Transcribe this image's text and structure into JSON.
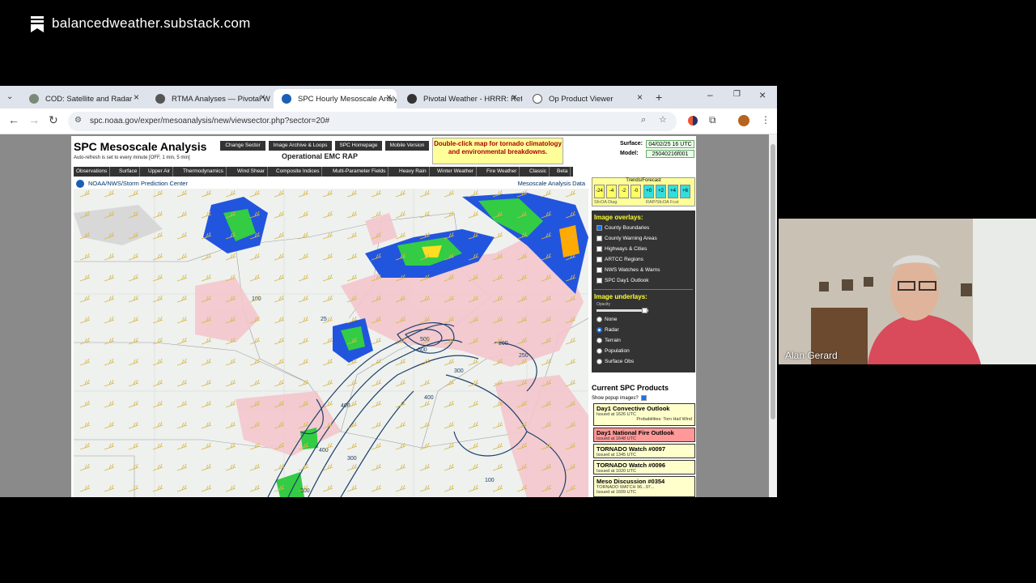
{
  "publication": {
    "title": "balancedweather.substack.com",
    "icon": "bookmark-icon"
  },
  "browser": {
    "tabs": [
      {
        "label": "COD: Satellite and Radar",
        "icon": "cod-icon",
        "active": false
      },
      {
        "label": "RTMA Analyses — Pivotal W",
        "icon": "gear-icon",
        "active": false
      },
      {
        "label": "SPC Hourly Mesoscale Analy",
        "icon": "noaa-icon",
        "active": true
      },
      {
        "label": "Pivotal Weather - HRRR: Ref",
        "icon": "pivotal-icon",
        "active": false
      },
      {
        "label": "Op Product Viewer",
        "icon": "globe-icon",
        "active": false
      }
    ],
    "url": "spc.noaa.gov/exper/mesoanalysis/new/viewsector.php?sector=20#"
  },
  "spc": {
    "title": "SPC Mesoscale Analysis",
    "autorefresh": "Auto-refresh is set to every minute [OFF, 1 min, 5 min]",
    "top_buttons": [
      "Change Sector",
      "Image Archive & Loops",
      "SPC Homepage",
      "Mobile Version"
    ],
    "model_name": "Operational EMC RAP",
    "dblclick_note": "Double-click map for tornado climatology and environmental breakdowns.",
    "surface_label": "Surface:",
    "surface_value": "04/02/25 16 UTC",
    "model_label": "Model:",
    "model_value": "25040216f001",
    "menu": [
      "Observations",
      "Surface",
      "Upper Air",
      "Thermodynamics",
      "Wind Shear",
      "Composite Indices",
      "Multi-Parameter Fields",
      "Heavy Rain",
      "Winter Weather",
      "Fire Weather",
      "Classic",
      "Beta"
    ],
    "map_left_label": "NOAA/NWS/Storm Prediction Center",
    "map_right_label": "Mesoscale Analysis Data",
    "trends": {
      "title": "Trends/Forecast",
      "buttons": [
        "-24",
        "-4",
        "-2",
        "-0",
        "+0",
        "+2",
        "+4",
        "+6"
      ],
      "sfc_label": "SfcOA Diag",
      "rap_label": "RAP/SfcOA Fcst"
    },
    "overlays_title": "Image overlays:",
    "overlays": [
      {
        "label": "County Boundaries",
        "checked": true
      },
      {
        "label": "County Warning Areas",
        "checked": false
      },
      {
        "label": "Highways & Cities",
        "checked": false
      },
      {
        "label": "ARTCC Regions",
        "checked": false
      },
      {
        "label": "NWS Watches & Warns",
        "checked": false
      },
      {
        "label": "SPC Day1 Outlook",
        "checked": false
      }
    ],
    "underlays_title": "Image underlays:",
    "opacity_label": "Opacity",
    "underlays": [
      {
        "label": "None",
        "selected": false
      },
      {
        "label": "Radar",
        "selected": true
      },
      {
        "label": "Terrain",
        "selected": false
      },
      {
        "label": "Population",
        "selected": false
      },
      {
        "label": "Surface Obs",
        "selected": false
      }
    ],
    "products_title": "Current SPC Products",
    "popup_label": "Show popup images?",
    "products": [
      {
        "name": "Day1 Convective Outlook",
        "issued": "Issued at 1626 UTC",
        "extra": "Probabilities: Torn Hail Wind",
        "color": "#ffffcc"
      },
      {
        "name": "Day1 National Fire Outlook",
        "issued": "Issued at 1648 UTC",
        "extra": "",
        "color": "#ff9999"
      },
      {
        "name": "TORNADO Watch #0097",
        "issued": "Issued at 1345 UTC",
        "extra": "",
        "color": "#ffffcc"
      },
      {
        "name": "TORNADO Watch #0096",
        "issued": "Issued at 1020 UTC",
        "extra": "",
        "color": "#ffffcc"
      },
      {
        "name": "Meso Discussion #0354",
        "issued": "TORNADO WATCH 96...97...",
        "extra": "Issued at 1609 UTC",
        "color": "#ffffcc"
      }
    ],
    "contour_labels": [
      "100",
      "25",
      "500",
      "600",
      "400",
      "300",
      "200",
      "300",
      "400",
      "300",
      "400",
      "250",
      "100"
    ]
  },
  "camera": {
    "name": "Alan Gerard"
  },
  "colors": {
    "accent": "#1a73e8",
    "menubar": "#333333",
    "trend_yellow": "#ffff66",
    "trend_cyan": "#33dddd"
  }
}
